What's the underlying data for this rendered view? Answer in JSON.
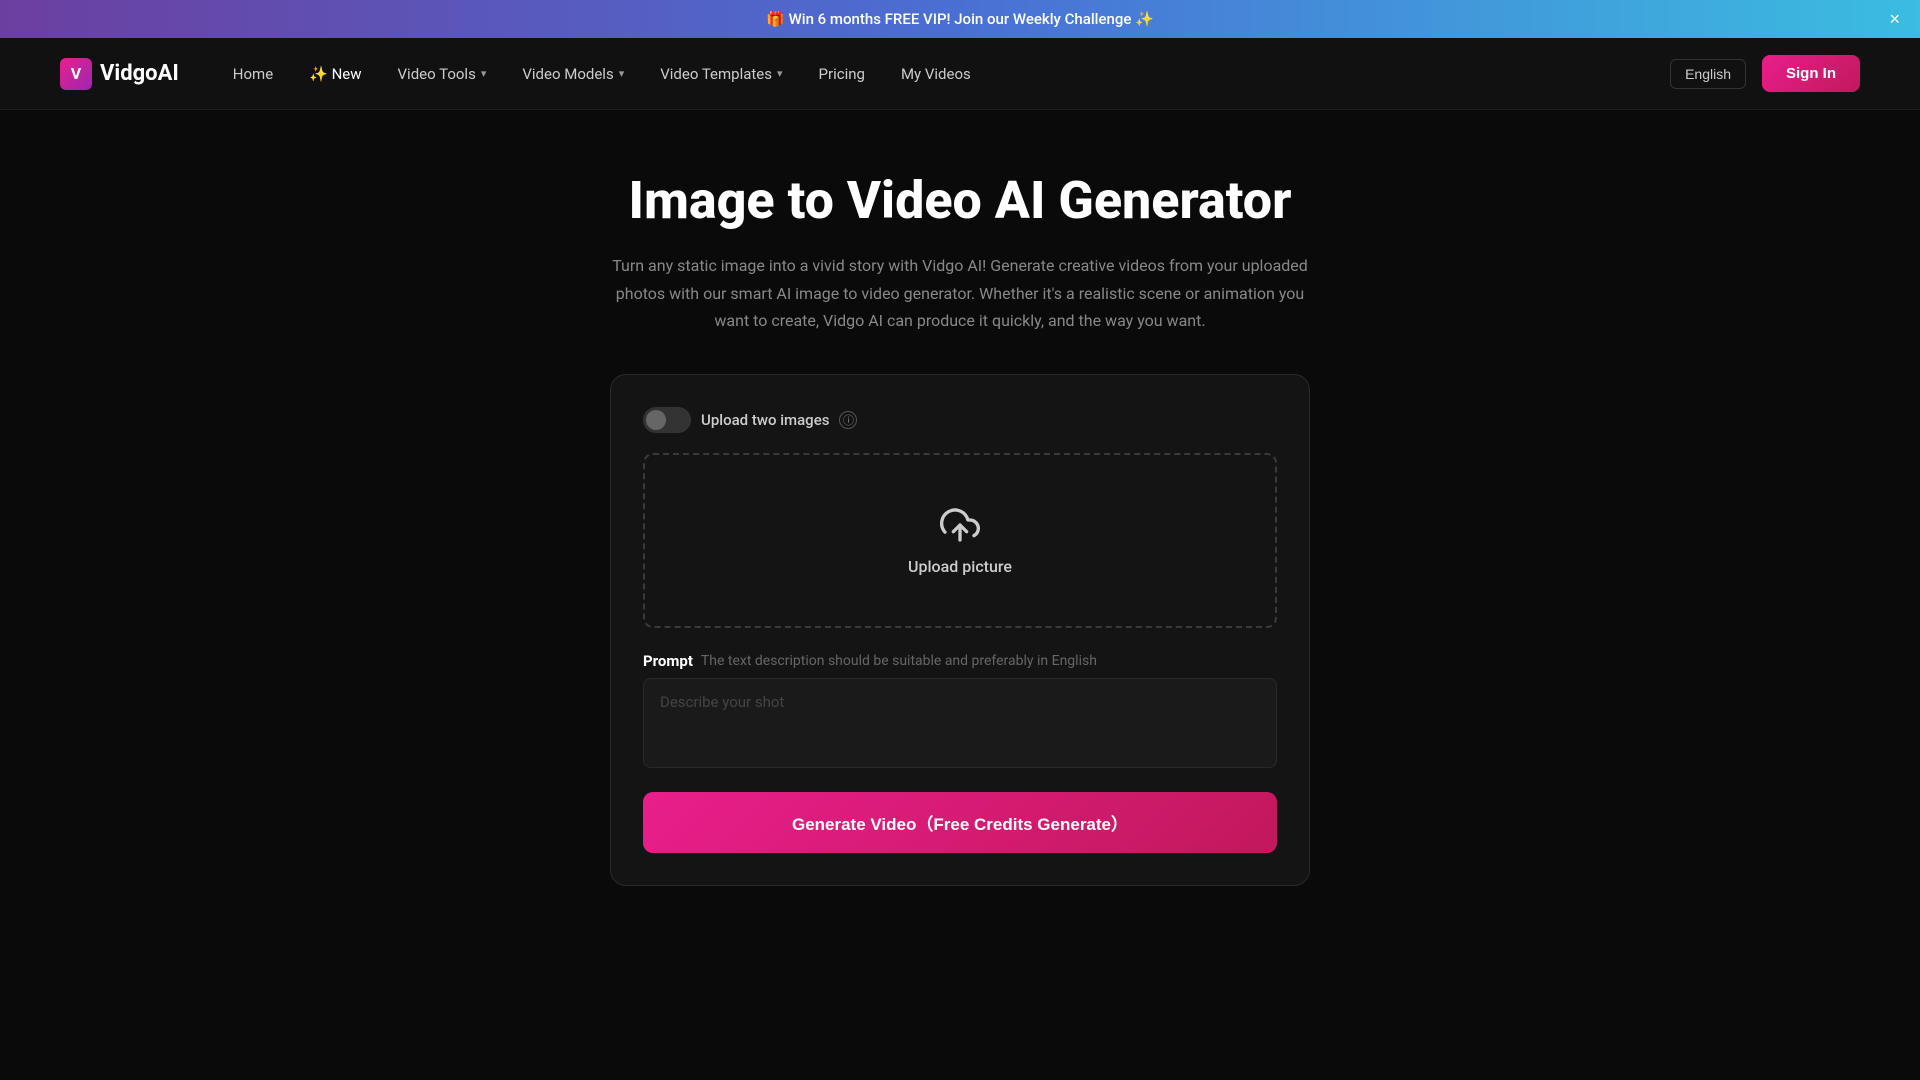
{
  "banner": {
    "text": "🎁 Win 6 months FREE VIP! Join our Weekly Challenge ✨",
    "close_label": "×"
  },
  "nav": {
    "logo_text": "VidgoAI",
    "logo_initial": "V",
    "links": [
      {
        "id": "home",
        "label": "Home",
        "has_dropdown": false
      },
      {
        "id": "new",
        "label": "✨ New",
        "has_dropdown": false
      },
      {
        "id": "video-tools",
        "label": "Video Tools",
        "has_dropdown": true
      },
      {
        "id": "video-models",
        "label": "Video Models",
        "has_dropdown": true
      },
      {
        "id": "video-templates",
        "label": "Video Templates",
        "has_dropdown": true
      },
      {
        "id": "pricing",
        "label": "Pricing",
        "has_dropdown": false
      },
      {
        "id": "my-videos",
        "label": "My Videos",
        "has_dropdown": false
      }
    ],
    "language": "English",
    "sign_in": "Sign In"
  },
  "page": {
    "title": "Image to Video AI Generator",
    "subtitle": "Turn any static image into a vivid story with Vidgo AI! Generate creative videos from your uploaded photos with our smart AI image to video generator. Whether it's a realistic scene or animation you want to create, Vidgo AI can produce it quickly, and the way you want."
  },
  "tool": {
    "toggle_label": "Upload two images",
    "upload_text": "Upload picture",
    "prompt_label": "Prompt",
    "prompt_hint": "The text description should be suitable and preferably in English",
    "prompt_placeholder": "Describe your shot",
    "generate_btn": "Generate Video（Free Credits Generate）"
  }
}
